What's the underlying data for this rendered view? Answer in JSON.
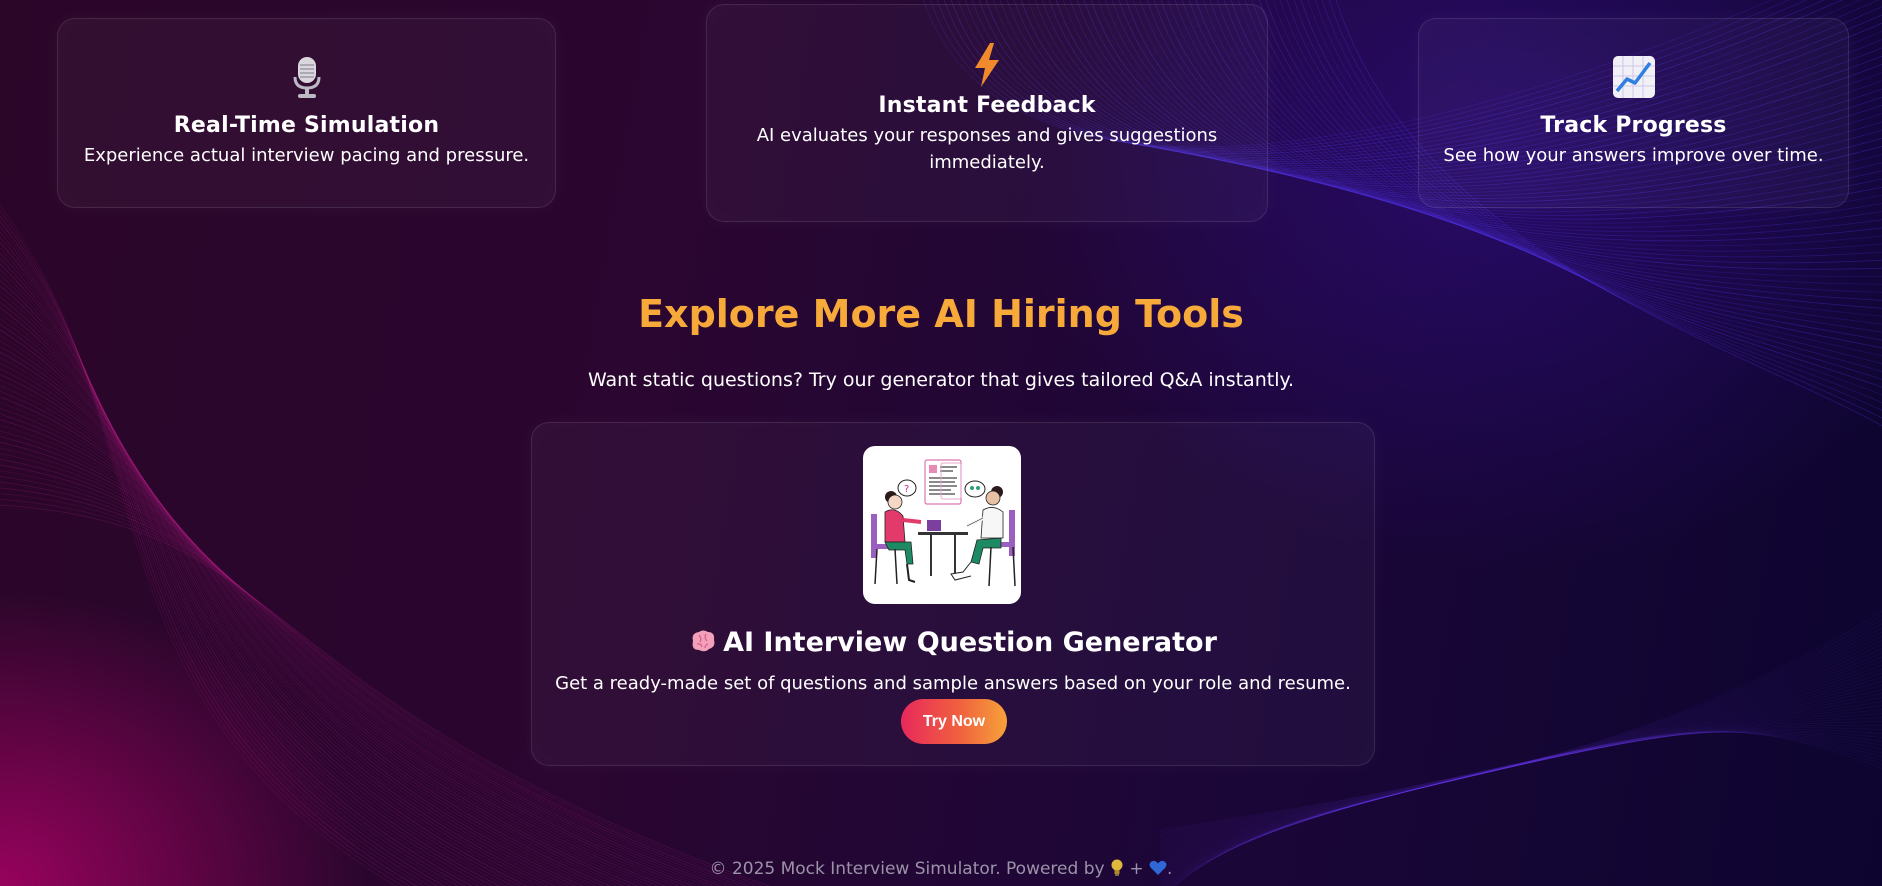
{
  "features": [
    {
      "icon": "microphone-icon",
      "title": "Real-Time Simulation",
      "desc": "Experience actual interview pacing and pressure."
    },
    {
      "icon": "lightning-icon",
      "title": "Instant Feedback",
      "desc": "AI evaluates your responses and gives suggestions immediately."
    },
    {
      "icon": "chart-increasing-icon",
      "title": "Track Progress",
      "desc": "See how your answers improve over time."
    }
  ],
  "explore": {
    "title": "Explore More AI Hiring Tools",
    "subtitle": "Want static questions? Try our generator that gives tailored Q&A instantly."
  },
  "tool": {
    "image_icon": "interview-illustration",
    "title_icon": "brain-icon",
    "title": "AI Interview Question Generator",
    "desc": "Get a ready-made set of questions and sample answers based on your role and resume.",
    "button_label": "Try Now"
  },
  "footer": {
    "text": "© 2025 Mock Interview Simulator. Powered by",
    "plus": "+",
    "end": ".",
    "icons": [
      "lightbulb-icon",
      "blue-heart-icon"
    ]
  },
  "colors": {
    "accent": "#f7a93a",
    "button_start": "#e8295c",
    "button_end": "#f7a23a"
  }
}
